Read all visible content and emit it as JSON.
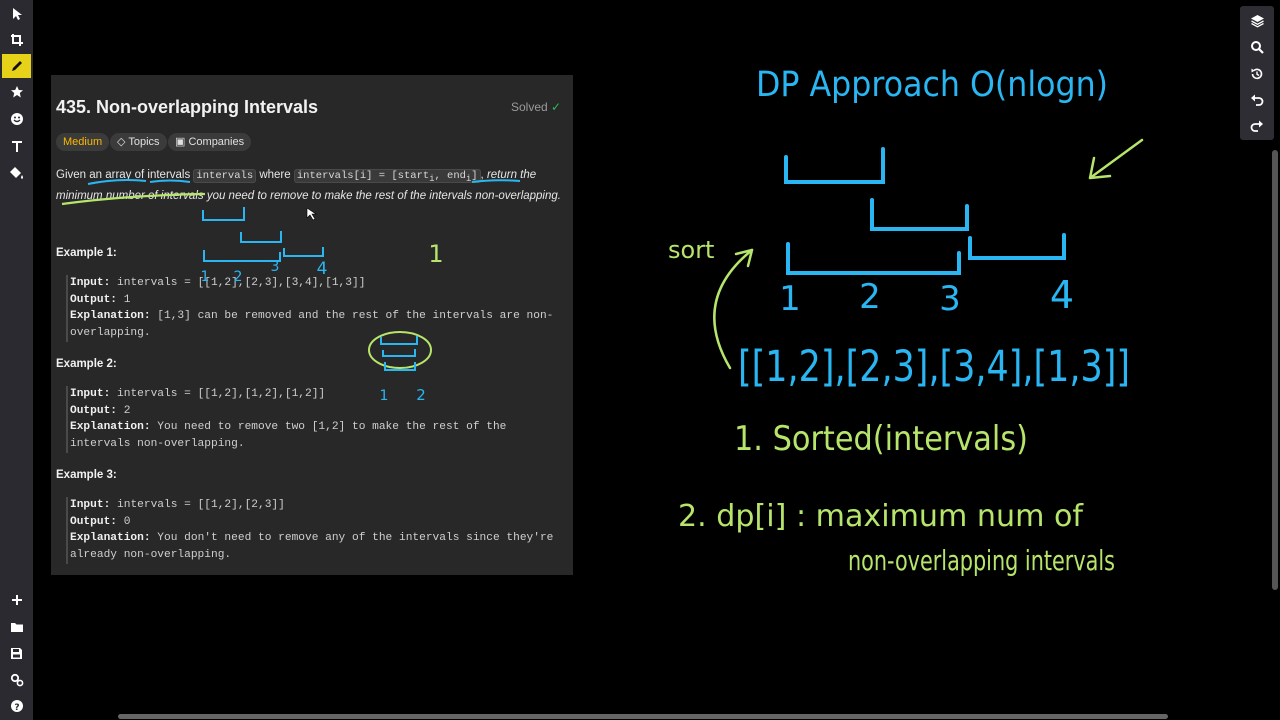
{
  "problem": {
    "title": "435. Non-overlapping Intervals",
    "status": "Solved",
    "difficulty": "Medium",
    "topics_label": "Topics",
    "companies_label": "Companies",
    "description": {
      "t1": "Given an array of intervals ",
      "code1": "intervals",
      "t2": " where ",
      "code2": "intervals[i] = [start",
      "code2_sub1": "i",
      "code2_mid": ", end",
      "code2_sub2": "i",
      "code2_end": "]",
      "t3": ", ",
      "ital": "return the minimum number of intervals you need to remove to make the rest of the intervals non-overlapping."
    },
    "examples": [
      {
        "heading": "Example 1:",
        "input_label": "Input:",
        "input": " intervals = [[1,2],[2,3],[3,4],[1,3]]",
        "output_label": "Output:",
        "output": " 1",
        "explanation_label": "Explanation:",
        "explanation": " [1,3] can be removed and the rest of the intervals are non-overlapping."
      },
      {
        "heading": "Example 2:",
        "input_label": "Input:",
        "input": " intervals = [[1,2],[1,2],[1,2]]",
        "output_label": "Output:",
        "output": " 2",
        "explanation_label": "Explanation:",
        "explanation": " You need to remove two [1,2] to make the rest of the intervals non-overlapping."
      },
      {
        "heading": "Example 3:",
        "input_label": "Input:",
        "input": " intervals = [[1,2],[2,3]]",
        "output_label": "Output:",
        "output": " 0",
        "explanation_label": "Explanation:",
        "explanation": " You don't need to remove any of the intervals since they're already non-overlapping."
      }
    ]
  },
  "whiteboard": {
    "heading": "DP Approach O(nlogn)",
    "sort_note": "sort",
    "interval_labels": [
      "1",
      "2",
      "3",
      "4"
    ],
    "intervals_text": "[[1,2],[2,3],[3,4],[1,3]]",
    "step1": "1. Sorted(intervals)",
    "step2_a": "2. dp[i] : maximum num of",
    "step2_b": "non-overlapping intervals",
    "panel_labels": [
      "1",
      "2",
      "3",
      "4"
    ],
    "panel_mark": "1",
    "panel_stack_labels": [
      "1",
      "2"
    ]
  },
  "toolbar": {
    "left_tools": [
      "pointer-icon",
      "crop-icon",
      "pen-icon",
      "star-icon",
      "emoji-icon",
      "text-icon",
      "fill-icon"
    ],
    "left_bottom_tools": [
      "plus-icon",
      "folder-icon",
      "save-icon",
      "settings-icon",
      "help-icon"
    ],
    "right_tools": [
      "layers-icon",
      "zoom-icon",
      "history-icon",
      "undo-icon",
      "redo-icon"
    ]
  },
  "colors": {
    "blue_ink": "#29b6f2",
    "green_ink": "#b7e56b",
    "yellow_ink": "#e6d319",
    "accent_tool": "#e6d319",
    "difficulty": "#ffb800",
    "solved_check": "#2cbb5d"
  }
}
